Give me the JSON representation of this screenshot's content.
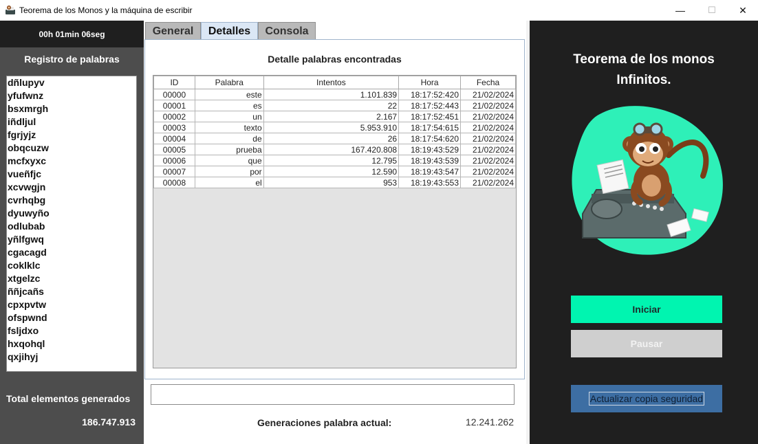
{
  "window": {
    "title": "Teorema de los Monos y la máquina de escribir",
    "minimize": "—",
    "maximize": "☐",
    "close": "✕"
  },
  "left": {
    "timer": "00h 01min 06seg",
    "registry_title": "Registro de palabras",
    "words": [
      "dñlupyv",
      "yfufwnz",
      "bsxmrgh",
      "iñdljul",
      "fgrjyjz",
      "obqcuzw",
      "mcfxyxc",
      "vueñfjc",
      "xcvwgjn",
      "cvrhqbg",
      "dyuwyño",
      "odlubab",
      "yñlfgwq",
      "cgacagd",
      "coklklc",
      "xtgelzc",
      "ññjcañs",
      "cpxpvtw",
      "ofspwnd",
      "fsljdxo",
      "hxqohql",
      "qxjihyj"
    ],
    "total_label": "Total elementos generados",
    "total_value": "186.747.913"
  },
  "tabs": [
    {
      "label": "General",
      "active": false
    },
    {
      "label": "Detalles",
      "active": true
    },
    {
      "label": "Consola",
      "active": false
    }
  ],
  "details": {
    "title": "Detalle palabras encontradas",
    "columns": [
      "ID",
      "Palabra",
      "Intentos",
      "Hora",
      "Fecha"
    ],
    "rows": [
      [
        "00000",
        "este",
        "1.101.839",
        "18:17:52:420",
        "21/02/2024"
      ],
      [
        "00001",
        "es",
        "22",
        "18:17:52:443",
        "21/02/2024"
      ],
      [
        "00002",
        "un",
        "2.167",
        "18:17:52:451",
        "21/02/2024"
      ],
      [
        "00003",
        "texto",
        "5.953.910",
        "18:17:54:615",
        "21/02/2024"
      ],
      [
        "00004",
        "de",
        "26",
        "18:17:54:620",
        "21/02/2024"
      ],
      [
        "00005",
        "prueba",
        "167.420.808",
        "18:19:43:529",
        "21/02/2024"
      ],
      [
        "00006",
        "que",
        "12.795",
        "18:19:43:539",
        "21/02/2024"
      ],
      [
        "00007",
        "por",
        "12.590",
        "18:19:43:547",
        "21/02/2024"
      ],
      [
        "00008",
        "el",
        "953",
        "18:19:43:553",
        "21/02/2024"
      ]
    ]
  },
  "input": {
    "value": ""
  },
  "generation": {
    "label": "Generaciones palabra actual:",
    "value": "12.241.262"
  },
  "right": {
    "title_line1": "Teorema de los monos",
    "title_line2": "Infinitos.",
    "start_button": "Iniciar",
    "pause_button": "Pausar",
    "backup_button": "Actualizar copia seguridad"
  },
  "colors": {
    "accent_green": "#00f5b0",
    "backup_blue": "#3d6ea3",
    "dark_panel": "#1f1f1f",
    "left_panel": "#4d4d4d"
  }
}
